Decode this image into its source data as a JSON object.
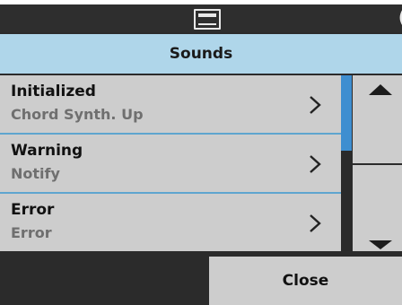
{
  "header": {
    "title": "Sounds"
  },
  "sounds": [
    {
      "name": "Initialized",
      "value": "Chord Synth. Up"
    },
    {
      "name": "Warning",
      "value": "Notify"
    },
    {
      "name": "Error",
      "value": "Error"
    }
  ],
  "footer": {
    "close_label": "Close"
  },
  "colors": {
    "header_bg": "#afd6ea",
    "accent": "#3e8ed0",
    "item_bg": "#cdcdcd"
  }
}
